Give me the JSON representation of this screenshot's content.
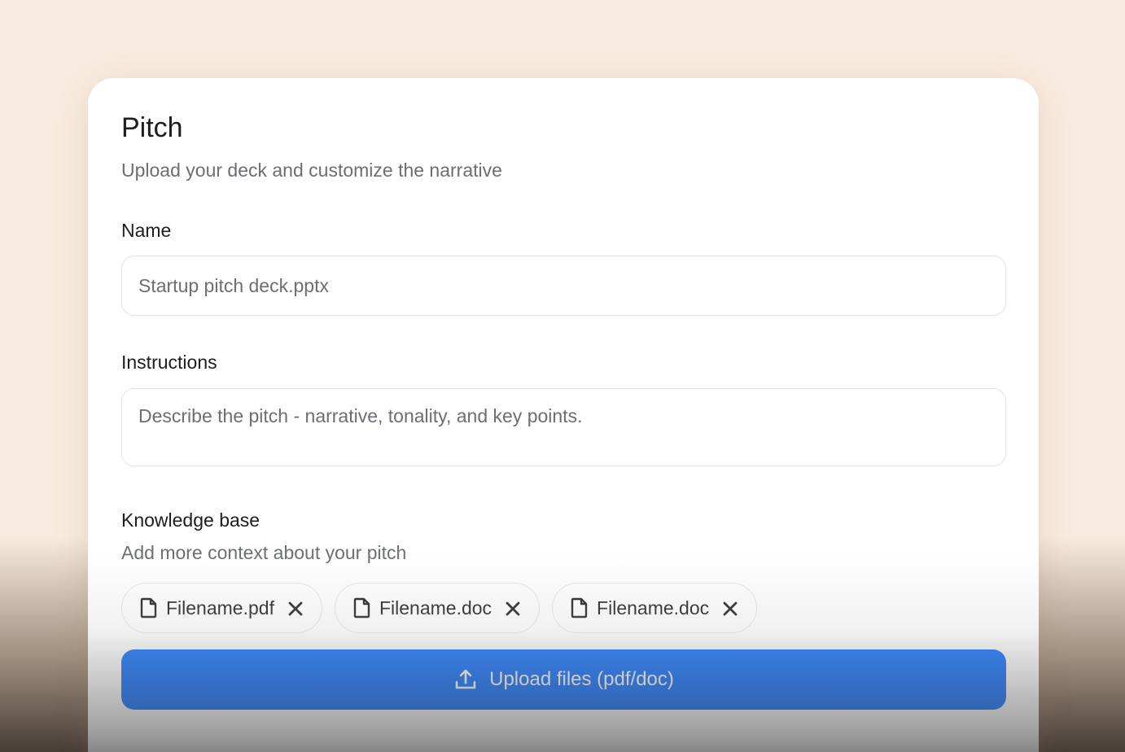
{
  "card": {
    "title": "Pitch",
    "subtitle": "Upload your deck and customize the narrative"
  },
  "name_field": {
    "label": "Name",
    "value": "Startup pitch deck.pptx"
  },
  "instructions_field": {
    "label": "Instructions",
    "placeholder": "Describe the pitch - narrative, tonality, and key points."
  },
  "knowledge_base": {
    "label": "Knowledge base",
    "subtitle": "Add more context about your pitch",
    "files": [
      {
        "name": "Filename.pdf",
        "icon": "file-icon"
      },
      {
        "name": "Filename.doc",
        "icon": "file-icon"
      },
      {
        "name": "Filename.doc",
        "icon": "file-icon"
      }
    ]
  },
  "upload_button": {
    "label": "Upload files (pdf/doc)",
    "icon": "upload-icon"
  },
  "colors": {
    "background": "#f8ebdf",
    "accent": "#0a6cff"
  }
}
